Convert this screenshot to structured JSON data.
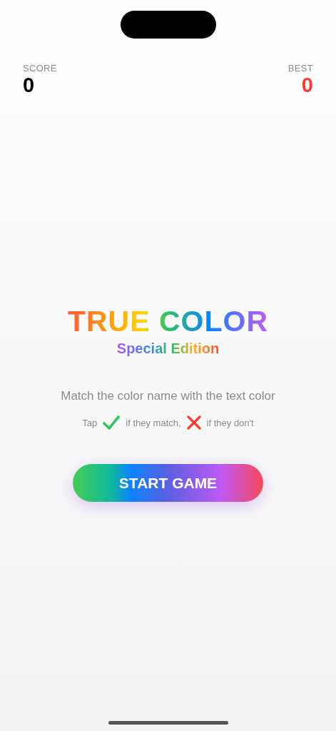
{
  "scoreboard": {
    "score": {
      "label": "SCORE",
      "value": "0"
    },
    "best": {
      "label": "BEST",
      "value": "0"
    }
  },
  "title": "TRUE COLOR",
  "subtitle": "Special Edition",
  "instructions": "Match the color name with the text color",
  "hint": {
    "tap": "Tap",
    "match": "if they match,",
    "mismatch": "if they don't"
  },
  "start_button": "START GAME"
}
